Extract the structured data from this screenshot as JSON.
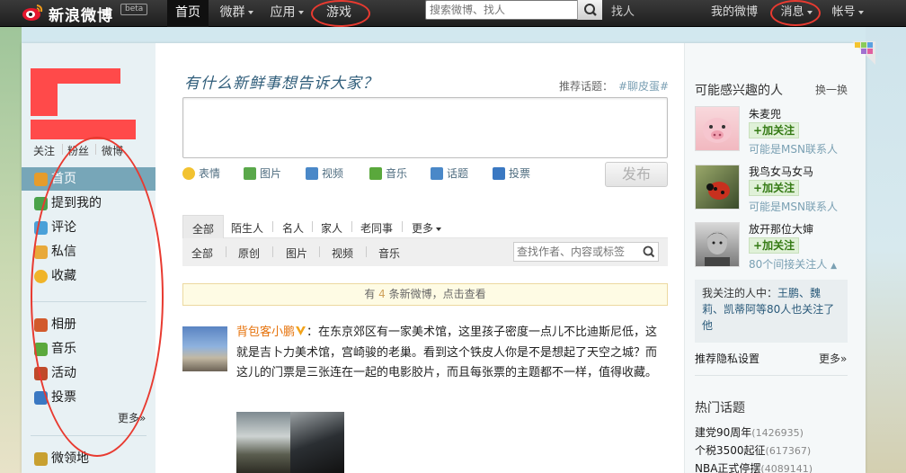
{
  "topnav": {
    "logo": "新浪微博",
    "beta": "beta",
    "items": [
      {
        "label": "首页",
        "dropdown": false
      },
      {
        "label": "微群",
        "dropdown": true
      },
      {
        "label": "应用",
        "dropdown": true
      },
      {
        "label": "游戏",
        "dropdown": false
      }
    ],
    "search_placeholder": "搜索微博、找人",
    "find_people": "找人",
    "my_weibo": "我的微博",
    "messages": "消息",
    "account": "帐号"
  },
  "profile": {
    "follow_label": "关注",
    "fans_label": "粉丝",
    "weibo_label": "微博"
  },
  "sidebar": {
    "items": [
      {
        "label": "首页",
        "icon": "home-icon",
        "color": "#e69c2b"
      },
      {
        "label": "提到我的",
        "icon": "at-icon",
        "color": "#4aa24a"
      },
      {
        "label": "评论",
        "icon": "comment-icon",
        "color": "#4aa0d8"
      },
      {
        "label": "私信",
        "icon": "mail-icon",
        "color": "#e8a93a"
      },
      {
        "label": "收藏",
        "icon": "star-icon",
        "color": "#f0b429"
      }
    ],
    "apps": [
      {
        "label": "相册",
        "icon": "album-icon",
        "color": "#d25a2c"
      },
      {
        "label": "音乐",
        "icon": "music-icon",
        "color": "#5aa83c"
      },
      {
        "label": "活动",
        "icon": "event-icon",
        "color": "#c04a2a"
      },
      {
        "label": "投票",
        "icon": "vote-icon",
        "color": "#3a78c2"
      }
    ],
    "more": "更多»",
    "weilingdi": {
      "label": "微领地",
      "icon": "territory-icon",
      "color": "#c8a030"
    }
  },
  "composer": {
    "prompt": "有什么新鲜事想告诉大家？",
    "topic_label": "推荐话题：",
    "topic_value": "#聊皮蛋#",
    "tools": [
      {
        "label": "表情",
        "icon": "emoji-icon",
        "color": "#f2c230"
      },
      {
        "label": "图片",
        "icon": "image-icon",
        "color": "#5aa84a"
      },
      {
        "label": "视频",
        "icon": "video-icon",
        "color": "#4a88c8"
      },
      {
        "label": "音乐",
        "icon": "music-note-icon",
        "color": "#5aa83c"
      },
      {
        "label": "话题",
        "icon": "topic-icon",
        "color": "#4a88c8"
      },
      {
        "label": "投票",
        "icon": "poll-icon",
        "color": "#3a78c2"
      }
    ],
    "publish": "发布"
  },
  "feed_tabs": {
    "primary": [
      "全部",
      "陌生人",
      "名人",
      "家人",
      "老同事",
      "更多"
    ],
    "secondary": [
      "全部",
      "原创",
      "图片",
      "视频",
      "音乐"
    ],
    "search_placeholder": "查找作者、内容或标签"
  },
  "notice": {
    "prefix": "有",
    "count": "4",
    "suffix": "条新微博，点击查看"
  },
  "post": {
    "author": "背包客小鹏",
    "text": "：在东京郊区有一家美术馆，这里孩子密度一点儿不比迪斯尼低，这就是吉卜力美术馆，宫崎骏的老巢。看到这个铁皮人你是不是想起了天空之城？而这儿的门票是三张连在一起的电影胶片，而且每张票的主题都不一样，值得收藏。"
  },
  "right": {
    "interest_title": "可能感兴趣的人",
    "refresh": "换一换",
    "people": [
      {
        "name": "朱麦兜",
        "follow": "加关注",
        "sub": "可能是MSN联系人",
        "avatar_color": "#f2c2c8"
      },
      {
        "name": "我鸟女马女马",
        "follow": "加关注",
        "sub": "可能是MSN联系人",
        "avatar_color": "#5a6a40"
      },
      {
        "name": "放开那位大婶",
        "follow": "加关注",
        "sub": "80个间接关注人",
        "avatar_color": "#8a8a8a"
      }
    ],
    "mutual_prefix": "我关注的人中：",
    "mutual_names": "王鹏、魏莉、凯蒂阿等80人也关注了他",
    "settings": "推荐隐私设置",
    "more": "更多»",
    "hot_title": "热门话题",
    "hot_topics": [
      {
        "label": "建党90周年",
        "count": "(1426935)"
      },
      {
        "label": "个税3500起征",
        "count": "(617367)"
      },
      {
        "label": "NBA正式停摆",
        "count": "(4089141)"
      }
    ]
  }
}
